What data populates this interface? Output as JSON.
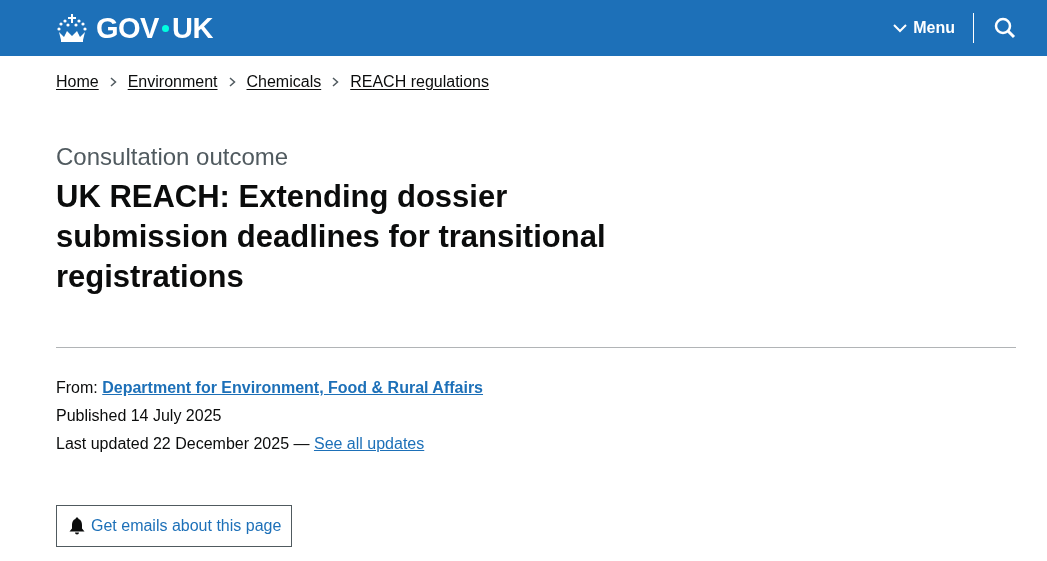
{
  "header": {
    "logo": {
      "left": "GOV",
      "right": "UK"
    },
    "menu": {
      "label": "Menu",
      "expanded": false
    }
  },
  "breadcrumbs": [
    "Home",
    "Environment",
    "Chemicals",
    "REACH regulations"
  ],
  "caption": "Consultation outcome",
  "title": "UK REACH: Extending dossier submission deadlines for transitional registrations",
  "metadata": {
    "from_label": "From:",
    "from_link": "Department for Environment, Food & Rural Affairs",
    "published": "Published 14 July 2025",
    "updated": "Last updated 22 December 2025 —",
    "updates_link": "See all updates"
  },
  "email_button": "Get emails about this page"
}
